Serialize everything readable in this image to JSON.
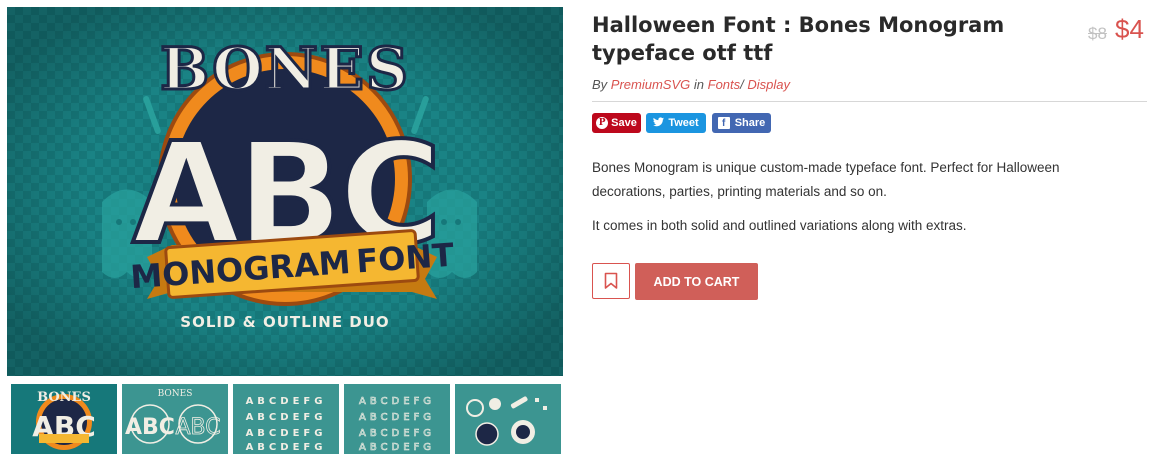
{
  "product": {
    "title": "Halloween Font : Bones Monogram typeface otf ttf",
    "price_old": "$8",
    "price_new": "$4",
    "by_prefix": "By",
    "author": "PremiumSVG",
    "in_word": "in",
    "category": "Fonts",
    "separator": "/",
    "subcategory": "Display",
    "description": [
      "Bones Monogram is unique custom-made typeface font. Perfect for Halloween decorations, parties, printing materials and so on.",
      "It comes in both solid and outlined variations along with extras."
    ]
  },
  "share": {
    "pinterest_label": "Save",
    "twitter_label": "Tweet",
    "facebook_label": "Share"
  },
  "actions": {
    "add_to_cart_label": "ADD TO CART",
    "wishlist_icon": "bookmark-icon"
  },
  "hero_image": {
    "lines": [
      "BONES",
      "ABC",
      "MONOGRAM",
      "FONT",
      "SOLID & OUTLINE DUO"
    ],
    "colors": {
      "teal": "#16787a",
      "navy": "#1d2746",
      "orange": "#f08a1d",
      "ribbon": "#f5b731",
      "bone": "#f1eee4"
    }
  },
  "thumb_texts": {
    "t1": [
      "BONES",
      "ABC"
    ],
    "t2": [
      "BONES",
      "ABC",
      "ABC"
    ],
    "t3": "ABCDEFG",
    "t4": "ABCDEFG"
  },
  "colors": {
    "accent": "#d9534f",
    "cart": "#d05f59",
    "pinterest": "#bd081c",
    "twitter": "#1b95e0",
    "facebook": "#4267b2"
  }
}
